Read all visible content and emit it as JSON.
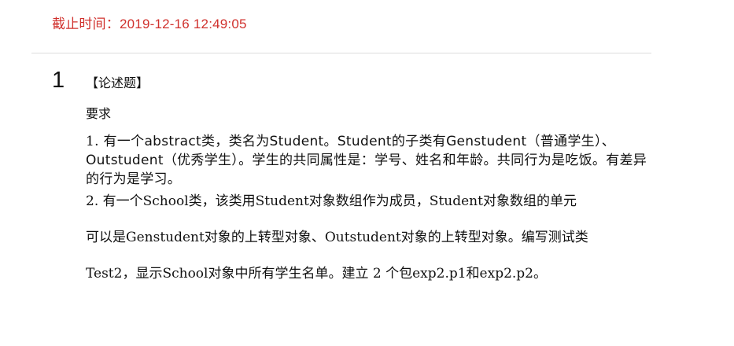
{
  "deadline": {
    "text": "截止时间：2019-12-16 12:49:05",
    "color": "#d0312d"
  },
  "question": {
    "number": "1",
    "type": "【论述题】",
    "requirement_label": "要求",
    "item1": {
      "prefix": "1.  有一个",
      "abstract": "abstract",
      "mid1": "类，类名为",
      "student1": "Student",
      "mid2": "。",
      "student2": "Student",
      "mid3": "的子类有",
      "genstudent": "Genstudent",
      "mid4": "（普通学生）、",
      "outstudent": "Outstudent",
      "rest": "（优秀学生）。学生的共同属性是：学号、姓名和年龄。共同行为是吃饭。有差异的行为是学习。"
    },
    "item2_line1": "2.  有一个School类，该类用Student对象数组作为成员，Student对象数组的单元",
    "item2_line2": "可以是Genstudent对象的上转型对象、Outstudent对象的上转型对象。编写测试类",
    "item2_line3": "Test2，显示School对象中所有学生名单。建立 2 个包exp2.p1和exp2.p2。"
  }
}
